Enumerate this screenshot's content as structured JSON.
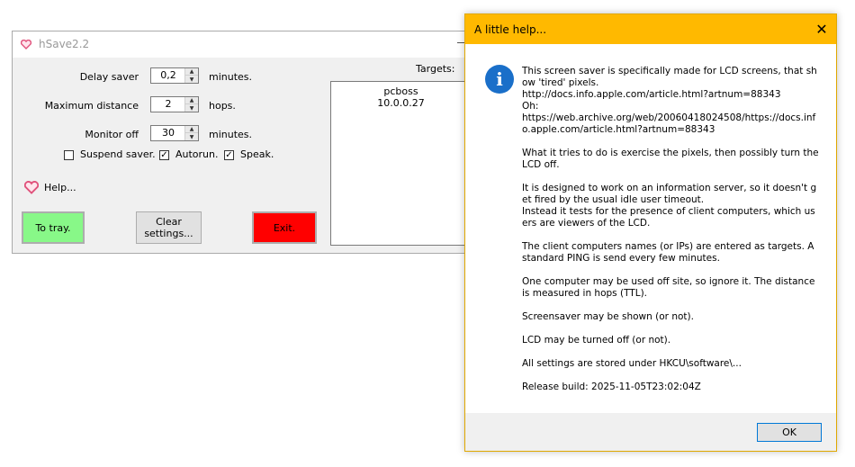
{
  "main_window": {
    "title": "hSave2.2",
    "delay_saver": {
      "label": "Delay saver",
      "value": "0,2",
      "unit": "minutes."
    },
    "max_distance": {
      "label": "Maximum distance",
      "value": "2",
      "unit": "hops."
    },
    "monitor_off": {
      "label": "Monitor off",
      "value": "30",
      "unit": "minutes."
    },
    "checkboxes": [
      {
        "label": "Suspend saver.",
        "checked": false,
        "mark": ""
      },
      {
        "label": "Autorun.",
        "checked": true,
        "mark": "✓"
      },
      {
        "label": "Speak.",
        "checked": true,
        "mark": "✓"
      }
    ],
    "help_label": "Help...",
    "targets_label": "Targets:",
    "targets": [
      "pcboss",
      "10.0.0.27"
    ],
    "buttons": {
      "tray": "To tray.",
      "clear_line1": "Clear",
      "clear_line2": "settings...",
      "exit": "Exit."
    },
    "colors": {
      "tray": "#88f888",
      "exit": "#ff0000"
    }
  },
  "help_dialog": {
    "title": "A little help...",
    "close_glyph": "✕",
    "icon": "info-icon",
    "icon_glyph": "i",
    "text": "This screen saver is specifically made for LCD screens, that show 'tired' pixels.\nhttp://docs.info.apple.com/article.html?artnum=88343\nOh:\nhttps://web.archive.org/web/20060418024508/https://docs.info.apple.com/article.html?artnum=88343\n\nWhat it tries to do is exercise the pixels, then possibly turn the LCD off.\n\nIt is designed to work on an information server, so it doesn't get fired by the usual idle user timeout.\nInstead it tests for the presence of client computers, which users are viewers of the LCD.\n\nThe client computers names (or IPs) are entered as targets. A standard PING is send every few minutes.\n\nOne computer may be used off site, so ignore it. The distance is measured in hops (TTL).\n\nScreensaver may be shown (or not).\n\nLCD may be turned off (or not).\n\nAll settings are stored under HKCU\\software\\...\n\nRelease build: 2025-11-05T23:02:04Z",
    "ok_label": "OK",
    "title_color": "#ffb900"
  }
}
